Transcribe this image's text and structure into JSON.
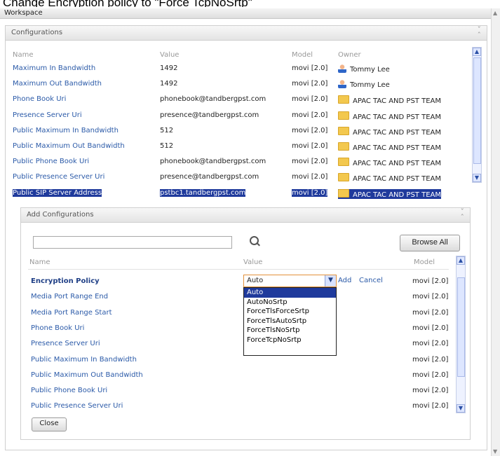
{
  "caption": "Change Encryption policy to \"Force TcpNoSrtp\"",
  "workspace": {
    "title": "Workspace"
  },
  "configurations": {
    "title": "Configurations",
    "columns": {
      "name": "Name",
      "value": "Value",
      "model": "Model",
      "owner": "Owner"
    },
    "rows": [
      {
        "name": "Maximum In Bandwidth",
        "value": "1492",
        "model": "movi [2.0]",
        "owner": "Tommy Lee",
        "owner_icon": "user-icon"
      },
      {
        "name": "Maximum Out Bandwidth",
        "value": "1492",
        "model": "movi [2.0]",
        "owner": "Tommy Lee",
        "owner_icon": "user-icon"
      },
      {
        "name": "Phone Book Uri",
        "value": "phonebook@tandbergpst.com",
        "model": "movi [2.0]",
        "owner": "APAC TAC AND PST TEAM",
        "owner_icon": "folder-icon"
      },
      {
        "name": "Presence Server Uri",
        "value": "presence@tandbergpst.com",
        "model": "movi [2.0]",
        "owner": "APAC TAC AND PST TEAM",
        "owner_icon": "folder-icon"
      },
      {
        "name": "Public Maximum In Bandwidth",
        "value": "512",
        "model": "movi [2.0]",
        "owner": "APAC TAC AND PST TEAM",
        "owner_icon": "folder-icon"
      },
      {
        "name": "Public Maximum Out Bandwidth",
        "value": "512",
        "model": "movi [2.0]",
        "owner": "APAC TAC AND PST TEAM",
        "owner_icon": "folder-icon"
      },
      {
        "name": "Public Phone Book Uri",
        "value": "phonebook@tandbergpst.com",
        "model": "movi [2.0]",
        "owner": "APAC TAC AND PST TEAM",
        "owner_icon": "folder-icon"
      },
      {
        "name": "Public Presence Server Uri",
        "value": "presence@tandbergpst.com",
        "model": "movi [2.0]",
        "owner": "APAC TAC AND PST TEAM",
        "owner_icon": "folder-icon"
      },
      {
        "name": "Public SIP Server Address",
        "value": "pstbc1.tandbergpst.com",
        "model": "movi [2.0]",
        "owner": "APAC TAC AND PST TEAM",
        "owner_icon": "folder-icon"
      }
    ],
    "selected_row": 8
  },
  "add_configurations": {
    "title": "Add Configurations",
    "search_value": "",
    "browse_all_label": "Browse All",
    "columns": {
      "name": "Name",
      "value": "Value",
      "model": "Model"
    },
    "rows": [
      {
        "name": "Encryption Policy",
        "model": "movi [2.0]"
      },
      {
        "name": "Media Port Range End",
        "model": "movi [2.0]"
      },
      {
        "name": "Media Port Range Start",
        "model": "movi [2.0]"
      },
      {
        "name": "Phone Book Uri",
        "model": "movi [2.0]"
      },
      {
        "name": "Presence Server Uri",
        "model": "movi [2.0]"
      },
      {
        "name": "Public Maximum In Bandwidth",
        "model": "movi [2.0]"
      },
      {
        "name": "Public Maximum Out Bandwidth",
        "model": "movi [2.0]"
      },
      {
        "name": "Public Phone Book Uri",
        "model": "movi [2.0]"
      },
      {
        "name": "Public Presence Server Uri",
        "model": "movi [2.0]"
      }
    ],
    "editor": {
      "selected_value": "Auto",
      "add_label": "Add",
      "cancel_label": "Cancel",
      "options": [
        "Auto",
        "AutoNoSrtp",
        "ForceTlsForceSrtp",
        "ForceTlsAutoSrtp",
        "ForceTlsNoSrtp",
        "ForceTcpNoSrtp"
      ],
      "highlighted_option": 0
    },
    "close_label": "Close"
  },
  "colors": {
    "selection": "#1f3a9c",
    "link": "#2b5aa8",
    "focus_border": "#e2913a"
  }
}
